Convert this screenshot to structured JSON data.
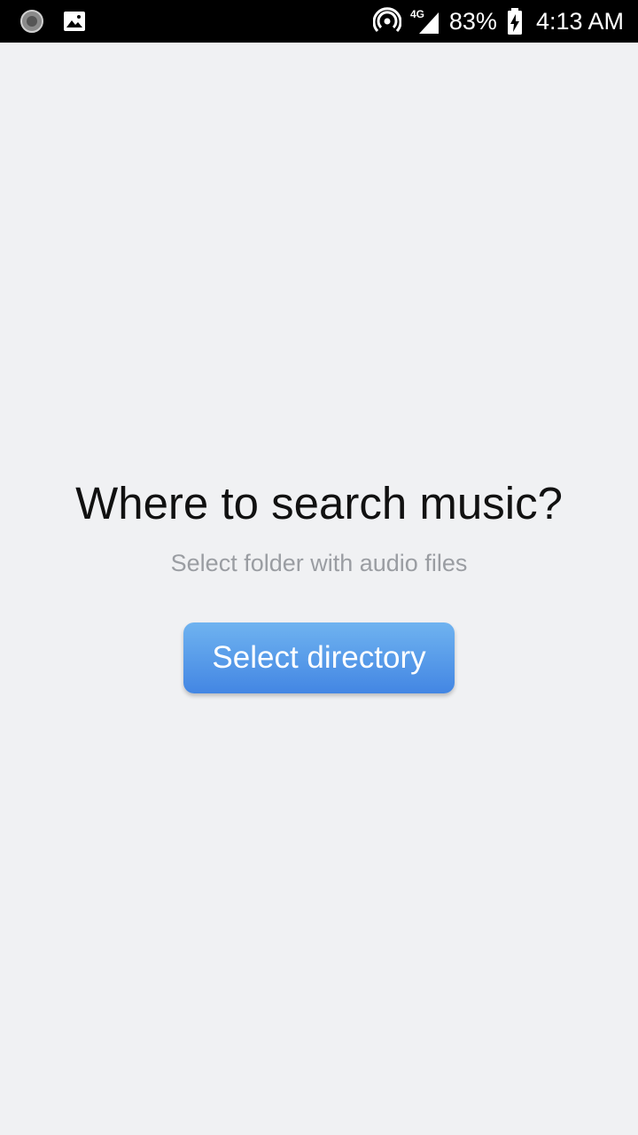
{
  "status_bar": {
    "left_icons": [
      "sync-spinner-icon",
      "image-icon"
    ],
    "right_icons": [
      "hotspot-icon",
      "signal-4g-icon",
      "battery-charging-icon"
    ],
    "network_label": "4G",
    "battery_percent": "83%",
    "time": "4:13 AM"
  },
  "main": {
    "title": "Where to search music?",
    "subtitle": "Select folder with audio files",
    "select_button_label": "Select directory"
  },
  "colors": {
    "background": "#f0f1f3",
    "status_bar": "#000000",
    "button_top": "#6fb3f0",
    "button_bottom": "#4386e3",
    "subtitle": "#9a9da2"
  }
}
